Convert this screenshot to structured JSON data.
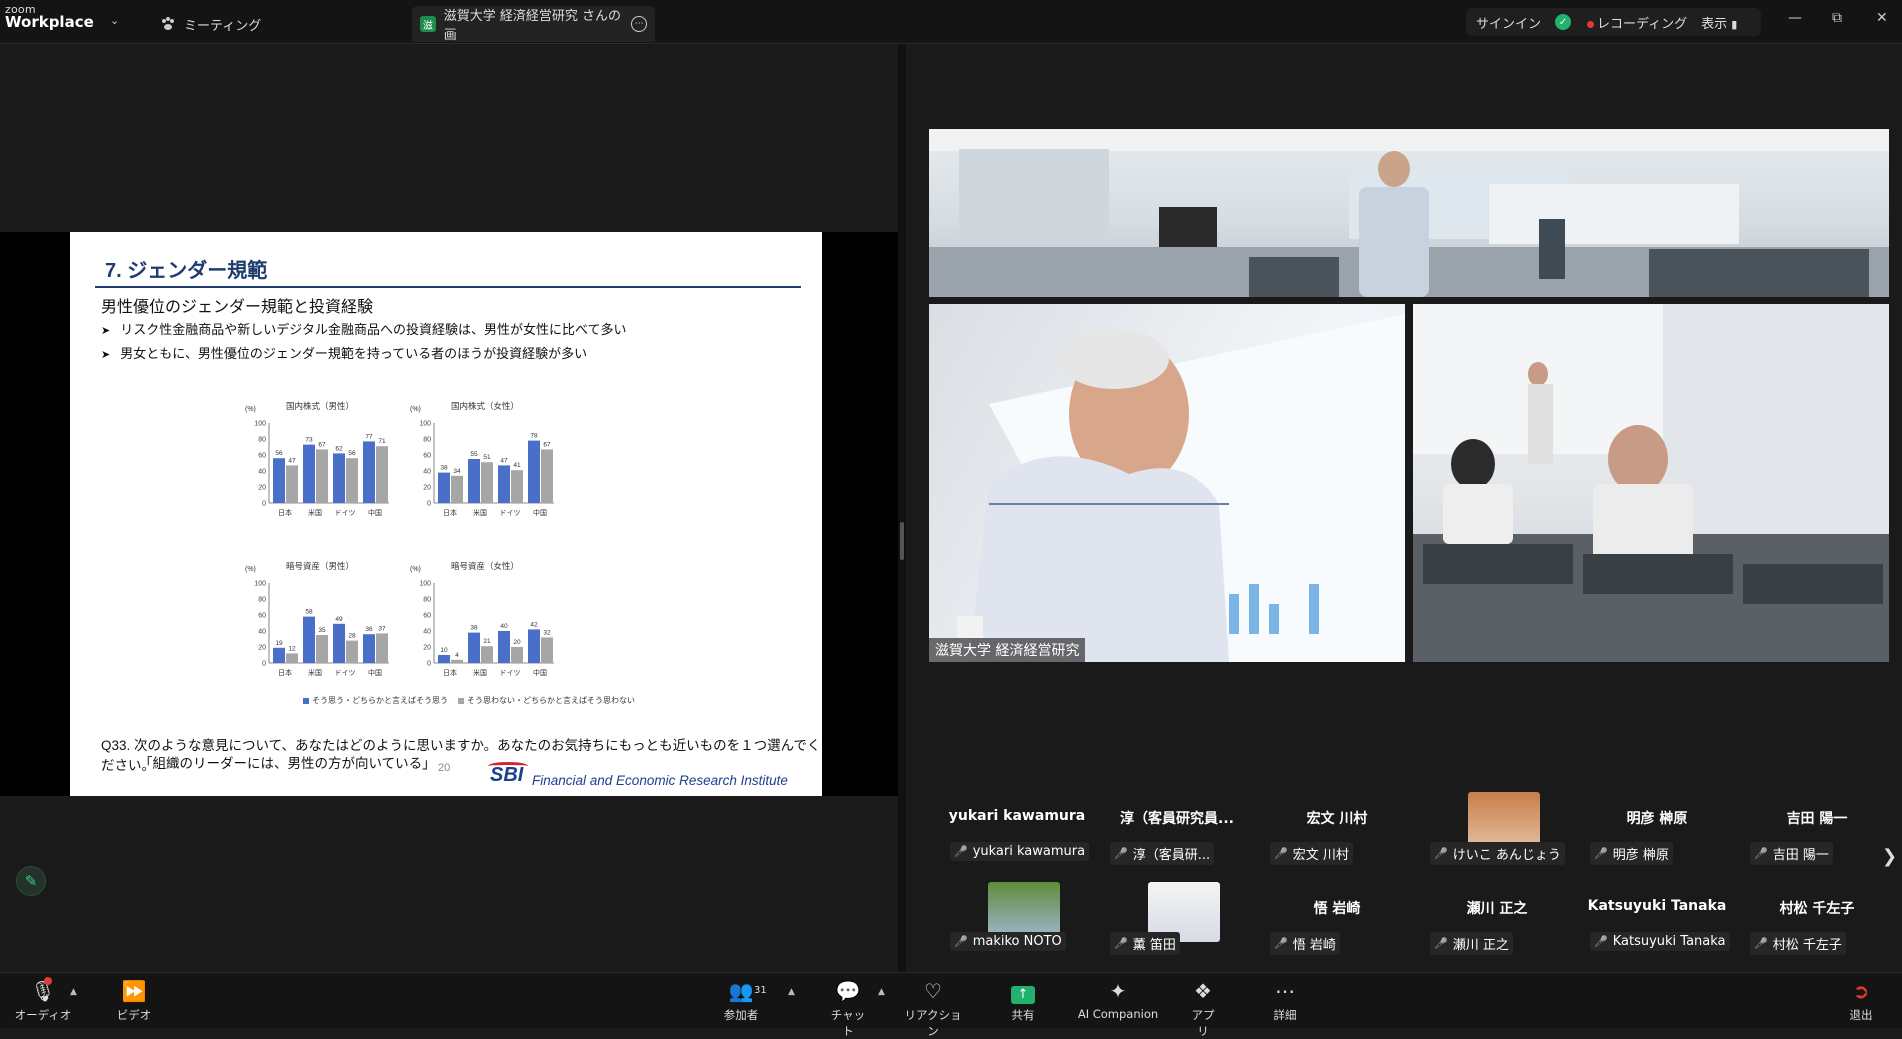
{
  "app": {
    "logo_top": "zoom",
    "logo_bottom": "Workplace"
  },
  "tabs": {
    "meeting": "ミーティング",
    "active": "滋賀大学 経済経営研究 さんの画"
  },
  "topbar": {
    "signin": "サインイン",
    "recording": "レコーディング",
    "view": "表示"
  },
  "slide": {
    "title": "7. ジェンダー規範",
    "subtitle": "男性優位のジェンダー規範と投資経験",
    "bullets": [
      "リスク性金融商品や新しいデジタル金融商品への投資経験は、男性が女性に比べて多い",
      "男女ともに、男性優位のジェンダー規範を持っている者のほうが投資経験が多い"
    ],
    "question_line1": "Q33. 次のような意見について、あなたはどのように思いますか。あなたのお気持ちにもっとも近いものを１つ選んでください。",
    "question_line2": "「組織のリーダーには、男性の方が向いている」",
    "page_number": "20",
    "brand": "SBI",
    "brand_tagline": "Financial and Economic Research Institute"
  },
  "chart_data": [
    {
      "type": "bar",
      "title": "国内株式（男性）",
      "ylabel": "(%)",
      "ylim": [
        0,
        100
      ],
      "categories": [
        "日本",
        "米国",
        "ドイツ",
        "中国"
      ],
      "series": [
        {
          "name": "そう思う・どちらかと言えばそう思う",
          "values": [
            56,
            73,
            62,
            77
          ]
        },
        {
          "name": "そう思わない・どちらかと言えばそう思わない",
          "values": [
            47,
            67,
            56,
            71
          ]
        }
      ]
    },
    {
      "type": "bar",
      "title": "国内株式（女性）",
      "ylabel": "(%)",
      "ylim": [
        0,
        100
      ],
      "categories": [
        "日本",
        "米国",
        "ドイツ",
        "中国"
      ],
      "series": [
        {
          "name": "そう思う・どちらかと言えばそう思う",
          "values": [
            38,
            55,
            47,
            78
          ]
        },
        {
          "name": "そう思わない・どちらかと言えばそう思わない",
          "values": [
            34,
            51,
            41,
            67
          ]
        }
      ]
    },
    {
      "type": "bar",
      "title": "暗号資産（男性）",
      "ylabel": "(%)",
      "ylim": [
        0,
        100
      ],
      "categories": [
        "日本",
        "米国",
        "ドイツ",
        "中国"
      ],
      "series": [
        {
          "name": "そう思う・どちらかと言えばそう思う",
          "values": [
            19,
            58,
            49,
            36
          ]
        },
        {
          "name": "そう思わない・どちらかと言えばそう思わない",
          "values": [
            12,
            35,
            28,
            37
          ]
        }
      ]
    },
    {
      "type": "bar",
      "title": "暗号資産（女性）",
      "ylabel": "(%)",
      "ylim": [
        0,
        100
      ],
      "categories": [
        "日本",
        "米国",
        "ドイツ",
        "中国"
      ],
      "series": [
        {
          "name": "そう思う・どちらかと言えばそう思う",
          "values": [
            10,
            38,
            40,
            42
          ]
        },
        {
          "name": "そう思わない・どちらかと言えばそう思わない",
          "values": [
            4,
            21,
            20,
            32
          ]
        }
      ]
    }
  ],
  "chart_colors": {
    "series1": "#4a6fc9",
    "series2": "#a6a6a6"
  },
  "legend": {
    "s1": "そう思う・どちらかと言えばそう思う",
    "s2": "そう思わない・どちらかと言えばそう思わない"
  },
  "videos": {
    "main_label": "滋賀大学 経済経営研究"
  },
  "participants": [
    {
      "name": "yukari kawamura",
      "label": "yukari kawamura",
      "avatar": false
    },
    {
      "name": "淳（客員研究員...",
      "label": "淳（客員研...",
      "avatar": false
    },
    {
      "name": "宏文 川村",
      "label": "宏文 川村",
      "avatar": false
    },
    {
      "name": "",
      "label": "けいこ あんじょう",
      "avatar": true
    },
    {
      "name": "明彦 榊原",
      "label": "明彦 榊原",
      "avatar": false
    },
    {
      "name": "吉田 陽一",
      "label": "吉田 陽一",
      "avatar": false
    },
    {
      "name": "",
      "label": "makiko NOTO",
      "avatar": true
    },
    {
      "name": "",
      "label": "薫 笛田",
      "avatar": true
    },
    {
      "name": "悟 岩崎",
      "label": "悟 岩崎",
      "avatar": false
    },
    {
      "name": "瀬川 正之",
      "label": "瀬川 正之",
      "avatar": false
    },
    {
      "name": "Katsuyuki Tanaka",
      "label": "Katsuyuki Tanaka",
      "avatar": false
    },
    {
      "name": "村松 千左子",
      "label": "村松 千左子",
      "avatar": false
    }
  ],
  "toolbar": {
    "audio": "オーディオ",
    "video": "ビデオ",
    "participants": "参加者",
    "participants_count": "31",
    "chat": "チャット",
    "reactions": "リアクション",
    "share": "共有",
    "ai": "AI Companion",
    "apps": "アプリ",
    "more": "詳細",
    "leave": "退出"
  }
}
